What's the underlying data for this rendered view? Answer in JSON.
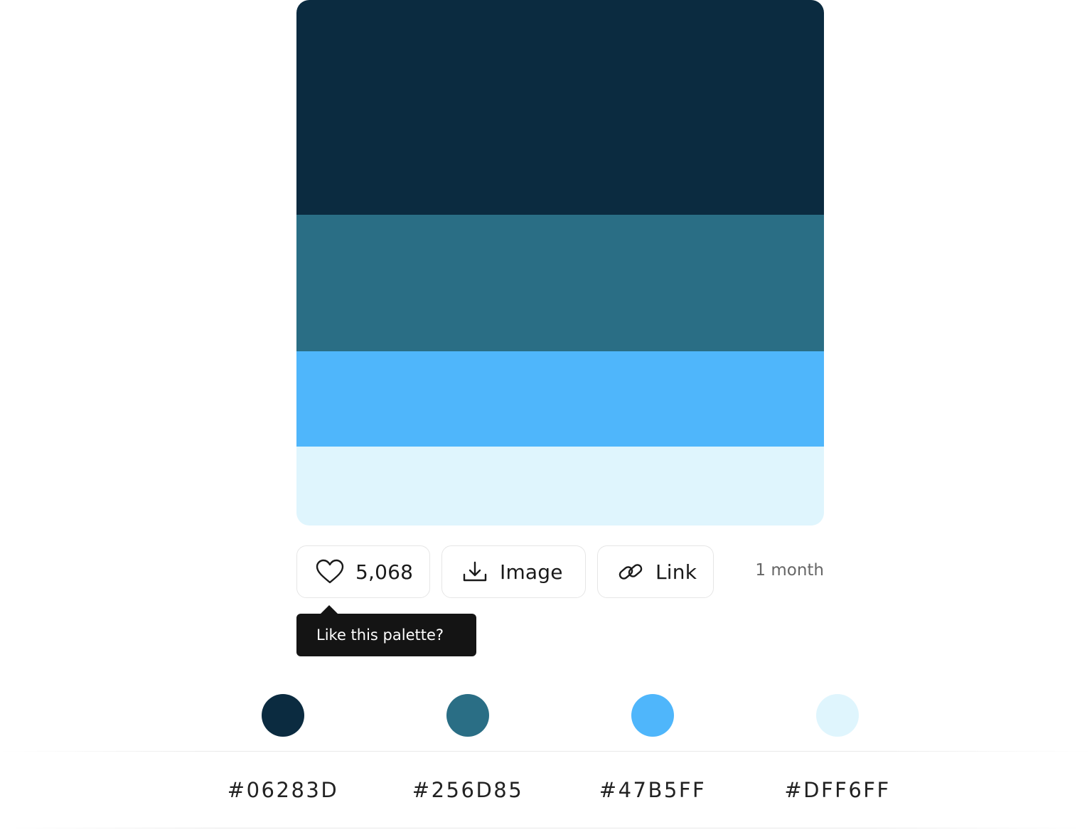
{
  "palette": {
    "colors": [
      "#0B2B40",
      "#2A6E85",
      "#4FB6FB",
      "#DFF5FD"
    ]
  },
  "actions": {
    "likes": "5,068",
    "image_label": "Image",
    "link_label": "Link",
    "age": "1 month",
    "icons": [
      "heart-icon",
      "download-icon",
      "link-icon"
    ]
  },
  "tooltip": {
    "text": "Like this palette?"
  },
  "swatches": [
    {
      "hex": "#06283D",
      "color": "#0B2B40"
    },
    {
      "hex": "#256D85",
      "color": "#2A6E85"
    },
    {
      "hex": "#47B5FF",
      "color": "#4FB6FB"
    },
    {
      "hex": "#DFF6FF",
      "color": "#DFF5FD"
    }
  ]
}
